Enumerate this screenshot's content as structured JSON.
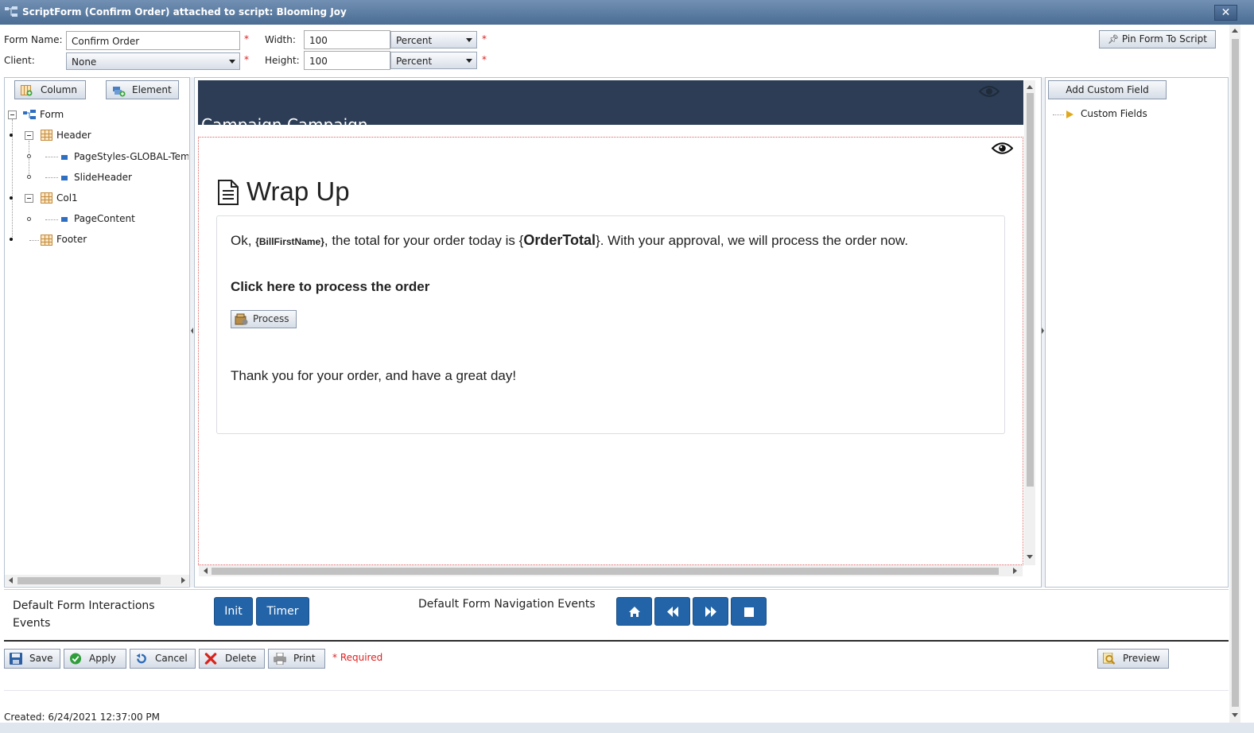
{
  "window": {
    "title": "ScriptForm (Confirm Order) attached to script: Blooming Joy",
    "close_label": "✕"
  },
  "form": {
    "name_label": "Form Name:",
    "name_value": "Confirm Order",
    "client_label": "Client:",
    "client_value": "None",
    "width_label": "Width:",
    "width_value": "100",
    "width_unit": "Percent",
    "height_label": "Height:",
    "height_value": "100",
    "height_unit": "Percent",
    "required_mark": "*",
    "pin_label": "Pin Form To Script"
  },
  "left_toolbar": {
    "column_label": "Column",
    "element_label": "Element"
  },
  "tree": {
    "root": "Form",
    "header": "Header",
    "page_styles": "PageStyles-GLOBAL-Temp",
    "slide_header": "SlideHeader",
    "col1": "Col1",
    "page_content": "PageContent",
    "footer": "Footer"
  },
  "preview": {
    "header_text": "Campaign    Campaign",
    "page_title": "Wrap Up",
    "intro_ok": "Ok,",
    "intro_field1": "{BillFirstName}",
    "intro_mid": ", the total for your order today is",
    "intro_field2_open": "{",
    "intro_field2": "OrderTotal",
    "intro_field2_close": "}",
    "intro_end": ".  With your approval, we will process the order now.",
    "process_heading": "Click here to process the order",
    "process_button": "Process",
    "thanks": "Thank you for your order, and have a great day!"
  },
  "right_panel": {
    "add_custom_field": "Add Custom Field",
    "custom_fields": "Custom Fields"
  },
  "events": {
    "interactions_label": "Default Form Interactions Events",
    "init": "Init",
    "timer": "Timer",
    "navigation_label": "Default Form Navigation Events"
  },
  "bottom_toolbar": {
    "save": "Save",
    "apply": "Apply",
    "cancel": "Cancel",
    "delete": "Delete",
    "print": "Print",
    "required_note": "* Required",
    "preview": "Preview"
  },
  "status": {
    "created": "Created:  6/24/2021 12:37:00 PM"
  }
}
